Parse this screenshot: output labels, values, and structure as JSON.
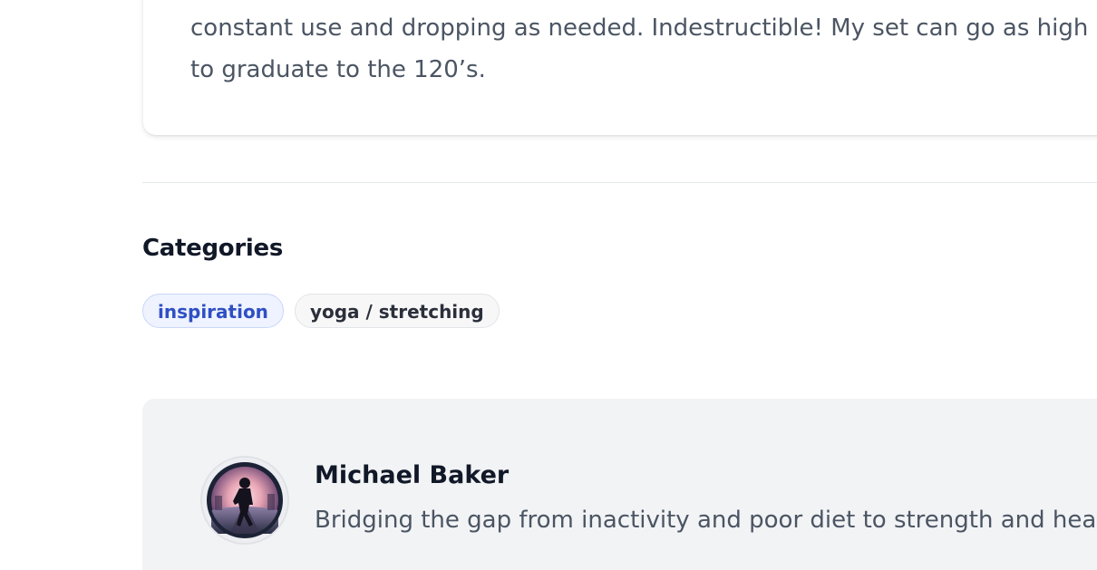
{
  "review": {
    "line1": "constant use and dropping as needed. Indestructible! My set can go as high",
    "line2": "to graduate to the 120’s."
  },
  "categories": {
    "title": "Categories",
    "tags": [
      {
        "label": "inspiration",
        "active": true
      },
      {
        "label": "yoga / stretching",
        "active": false
      }
    ]
  },
  "author": {
    "name": "Michael Baker",
    "bio": "Bridging the gap from inactivity and poor diet to strength and health",
    "avatar_icon": "runner-silhouette-avatar"
  },
  "colors": {
    "accent": "#2f4fc4",
    "tag_active_bg": "#eef3ff",
    "author_card_bg": "#f2f3f5",
    "body_text": "#4b5563"
  }
}
